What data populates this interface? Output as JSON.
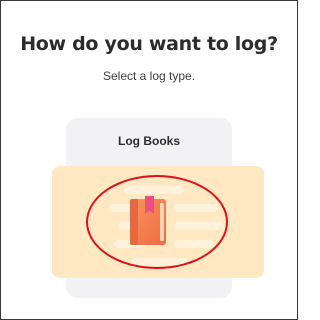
{
  "dialog": {
    "title": "How do you want to log?",
    "subtitle": "Select a log type."
  },
  "options": [
    {
      "label": "Log Books",
      "icon": "book-icon",
      "selected": true
    }
  ],
  "colors": {
    "card_background": "#f2f2f4",
    "highlight": "#ffe8c2",
    "book_orange": "#f47c52",
    "bookmark_pink": "#ef4f7e",
    "annotation_red": "#e0101a"
  }
}
